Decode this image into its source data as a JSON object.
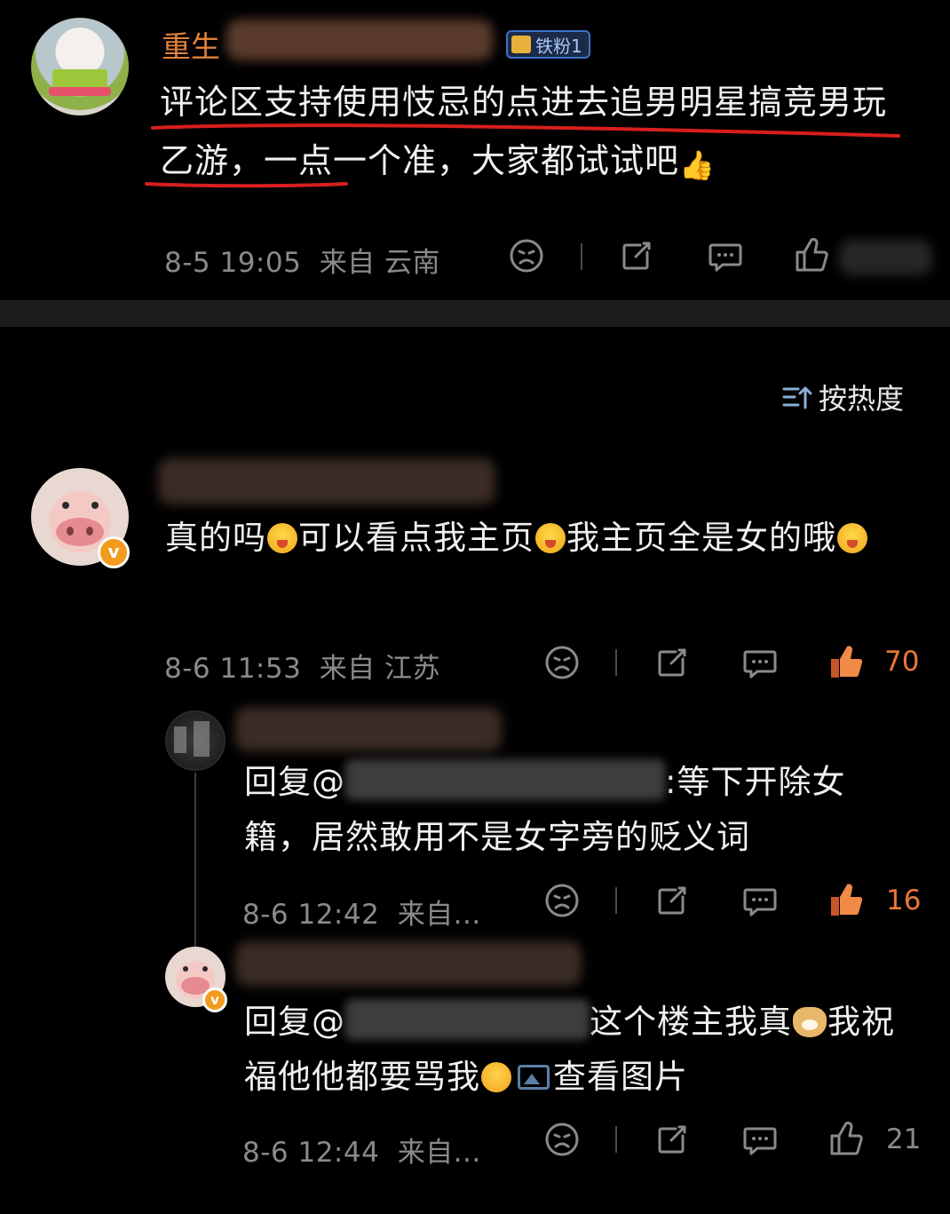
{
  "post": {
    "username_visible": "重生",
    "badge": "铁粉1",
    "content": "评论区支持使用忮忌的点进去追男明星搞竞男玩乙游，一点一个准，大家都试试吧",
    "thumb_emoji": "👍",
    "timestamp": "8-5 19:05",
    "source": "来自 云南"
  },
  "sort": {
    "label": "按热度"
  },
  "comments": [
    {
      "content": "真的吗",
      "content_2": "可以看点我主页",
      "content_3": "我主页全是女的哦",
      "timestamp": "8-6 11:53",
      "source": "来自 江苏",
      "likes": "70",
      "verified_badge": "v"
    },
    {
      "reply_prefix": "回复@",
      "reply_suffix": ":等下开除女籍，居然敢用不是女字旁的贬义词",
      "timestamp": "8-6 12:42",
      "source": "来自...",
      "likes": "16"
    },
    {
      "reply_prefix": "回复@",
      "reply_mid": "这个楼主我真",
      "reply_end": "我祝福他他都要骂我",
      "view_image": "查看图片",
      "timestamp": "8-6 12:44",
      "source": "来自...",
      "likes": "21",
      "verified_badge": "v"
    }
  ],
  "colors": {
    "accent_like": "#e8763a",
    "username_orange": "#e4823c",
    "annotation_red": "#d81e1e",
    "badge_blue": "#3f73c9"
  }
}
